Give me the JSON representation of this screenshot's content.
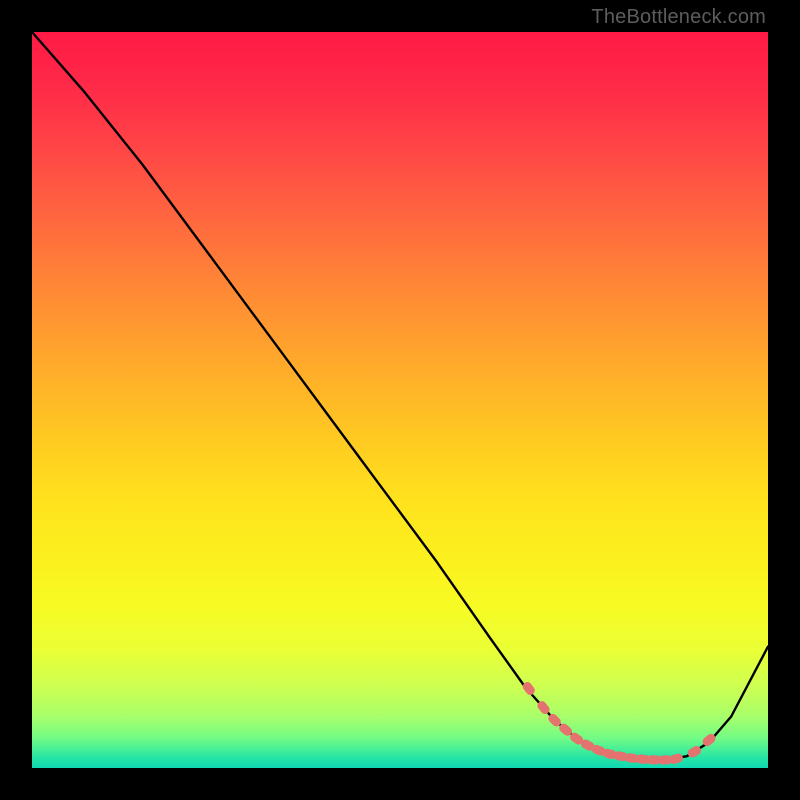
{
  "watermark": "TheBottleneck.com",
  "colors": {
    "marker": "#e4736f",
    "curve": "#000000",
    "frame": "#000000"
  },
  "chart_data": {
    "type": "line",
    "title": "",
    "xlabel": "",
    "ylabel": "",
    "xlim": [
      0,
      100
    ],
    "ylim": [
      0,
      100
    ],
    "grid": false,
    "legend": false,
    "series": [
      {
        "name": "bottleneck-curve",
        "x": [
          0,
          7,
          15,
          25,
          35,
          45,
          55,
          62,
          67,
          71,
          74,
          77,
          80,
          83,
          86,
          89,
          92,
          95,
          100
        ],
        "y": [
          100,
          92,
          82,
          68.5,
          55,
          41.5,
          28,
          18,
          11,
          6.5,
          4,
          2.4,
          1.6,
          1.2,
          1.1,
          1.6,
          3.5,
          7,
          16.5
        ]
      }
    ],
    "markers": {
      "name": "highlight-band",
      "x": [
        67.5,
        69.5,
        71,
        72.5,
        74,
        75.5,
        77,
        78.5,
        80,
        81.5,
        83,
        84.5,
        86,
        87.5,
        90,
        92
      ],
      "y": [
        10.8,
        8.2,
        6.5,
        5.2,
        4,
        3.1,
        2.4,
        1.9,
        1.6,
        1.35,
        1.2,
        1.12,
        1.1,
        1.25,
        2.2,
        3.8
      ]
    }
  }
}
